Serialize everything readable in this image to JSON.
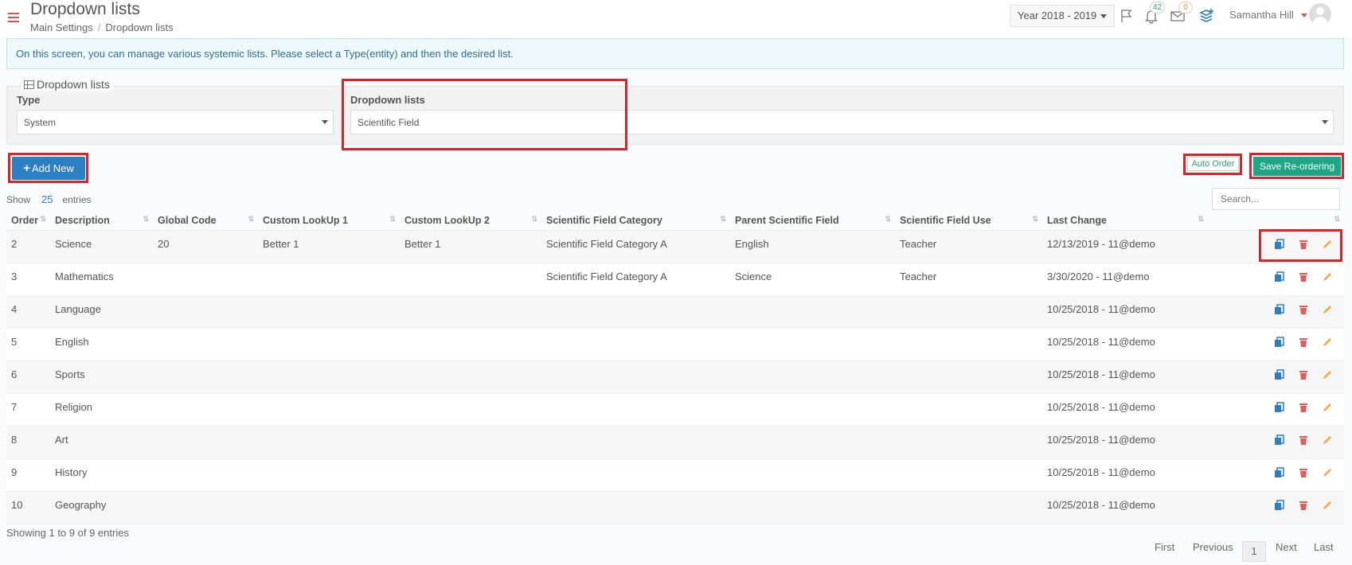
{
  "header": {
    "title": "Dropdown lists",
    "breadcrumb": [
      "Main Settings",
      "Dropdown lists"
    ],
    "year_select": "Year 2018 - 2019",
    "notifications_count": "42",
    "messages_count": "0",
    "user_name": "Samantha Hill"
  },
  "info_text": "On this screen, you can manage various systemic lists. Please select a Type(entity) and then the desired list.",
  "filters": {
    "legend": "Dropdown lists",
    "type_label": "Type",
    "type_value": "System",
    "list_label": "Dropdown lists",
    "list_value": "Scientific Field"
  },
  "toolbar": {
    "add_new": "Add New",
    "auto_order": "Auto Order",
    "save_reordering": "Save Re-ordering"
  },
  "table_controls": {
    "show_label": "Show",
    "page_size": "25",
    "entries_label": "entries",
    "search_placeholder": "Search..."
  },
  "table": {
    "columns": [
      "Order",
      "Description",
      "Global Code",
      "Custom LookUp 1",
      "Custom LookUp 2",
      "Scientific Field Category",
      "Parent Scientific Field",
      "Scientific Field Use",
      "Last Change"
    ],
    "rows": [
      [
        "2",
        "Science",
        "20",
        "Better 1",
        "Better 1",
        "Scientific Field Category A",
        "English",
        "Teacher",
        "12/13/2019 - 11@demo"
      ],
      [
        "3",
        "Mathematics",
        "",
        "",
        "",
        "Scientific Field Category A",
        "Science",
        "Teacher",
        "3/30/2020 - 11@demo"
      ],
      [
        "4",
        "Language",
        "",
        "",
        "",
        "",
        "",
        "",
        "10/25/2018 - 11@demo"
      ],
      [
        "5",
        "English",
        "",
        "",
        "",
        "",
        "",
        "",
        "10/25/2018 - 11@demo"
      ],
      [
        "6",
        "Sports",
        "",
        "",
        "",
        "",
        "",
        "",
        "10/25/2018 - 11@demo"
      ],
      [
        "7",
        "Religion",
        "",
        "",
        "",
        "",
        "",
        "",
        "10/25/2018 - 11@demo"
      ],
      [
        "8",
        "Art",
        "",
        "",
        "",
        "",
        "",
        "",
        "10/25/2018 - 11@demo"
      ],
      [
        "9",
        "History",
        "",
        "",
        "",
        "",
        "",
        "",
        "10/25/2018 - 11@demo"
      ],
      [
        "10",
        "Geography",
        "",
        "",
        "",
        "",
        "",
        "",
        "10/25/2018 - 11@demo"
      ]
    ]
  },
  "footer": {
    "info": "Showing 1 to 9 of 9 entries",
    "first": "First",
    "previous": "Previous",
    "current_page": "1",
    "next": "Next",
    "last": "Last"
  },
  "colors": {
    "highlight": "#d7232a",
    "primary": "#2a7fc5",
    "success": "#1fa686",
    "copy_icon": "#2a7fc5",
    "delete_icon": "#e35b5b",
    "edit_icon": "#f0ad4e"
  }
}
